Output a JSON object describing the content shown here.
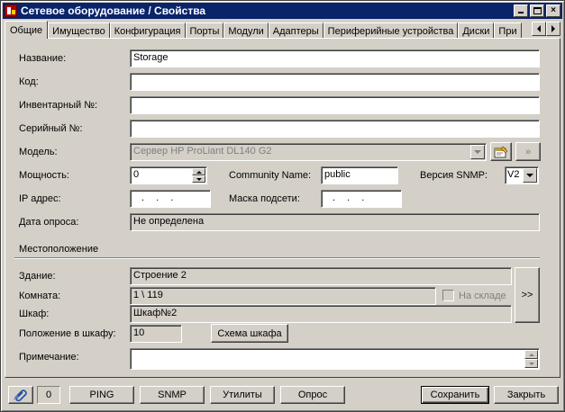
{
  "window": {
    "title": "Сетевое оборудование / Свойства",
    "minimize": "_",
    "maximize": "□",
    "close": "×"
  },
  "tabs": [
    "Общие",
    "Имущество",
    "Конфигурация",
    "Порты",
    "Модули",
    "Адаптеры",
    "Периферийные устройства",
    "Диски",
    "При"
  ],
  "form": {
    "name_label": "Название:",
    "name_value": "Storage",
    "code_label": "Код:",
    "code_value": "",
    "inventory_label": "Инвентарный №:",
    "inventory_value": "",
    "serial_label": "Серийный №:",
    "serial_value": "",
    "model_label": "Модель:",
    "model_value": "Сервер HP ProLiant DL140 G2",
    "model_more": "»",
    "power_label": "Мощность:",
    "power_value": "0",
    "community_label": "Community Name:",
    "community_value": "public",
    "snmp_version_label": "Версия SNMP:",
    "snmp_version_value": "V2",
    "ip_label": "IP адрес:",
    "ip_value": " .   .   . ",
    "mask_label": "Маска подсети:",
    "mask_value": " .   .   . ",
    "poll_date_label": "Дата опроса:",
    "poll_date_value": "Не определена"
  },
  "location": {
    "section_title": "Местоположение",
    "building_label": "Здание:",
    "building_value": "Строение 2",
    "room_label": "Комната:",
    "room_value": "1 \\ 119",
    "in_stock_label": "На складе",
    "cabinet_label": "Шкаф:",
    "cabinet_value": "Шкаф№2",
    "cabinet_position_label": "Положение в шкафу:",
    "cabinet_position_value": "10",
    "cabinet_scheme_button": "Схема шкафа",
    "browse_button": ">>",
    "note_label": "Примечание:",
    "note_value": ""
  },
  "footer": {
    "count": "0",
    "ping": "PING",
    "snmp": "SNMP",
    "utilities": "Утилиты",
    "poll": "Опрос",
    "save": "Сохранить",
    "close": "Закрыть"
  }
}
